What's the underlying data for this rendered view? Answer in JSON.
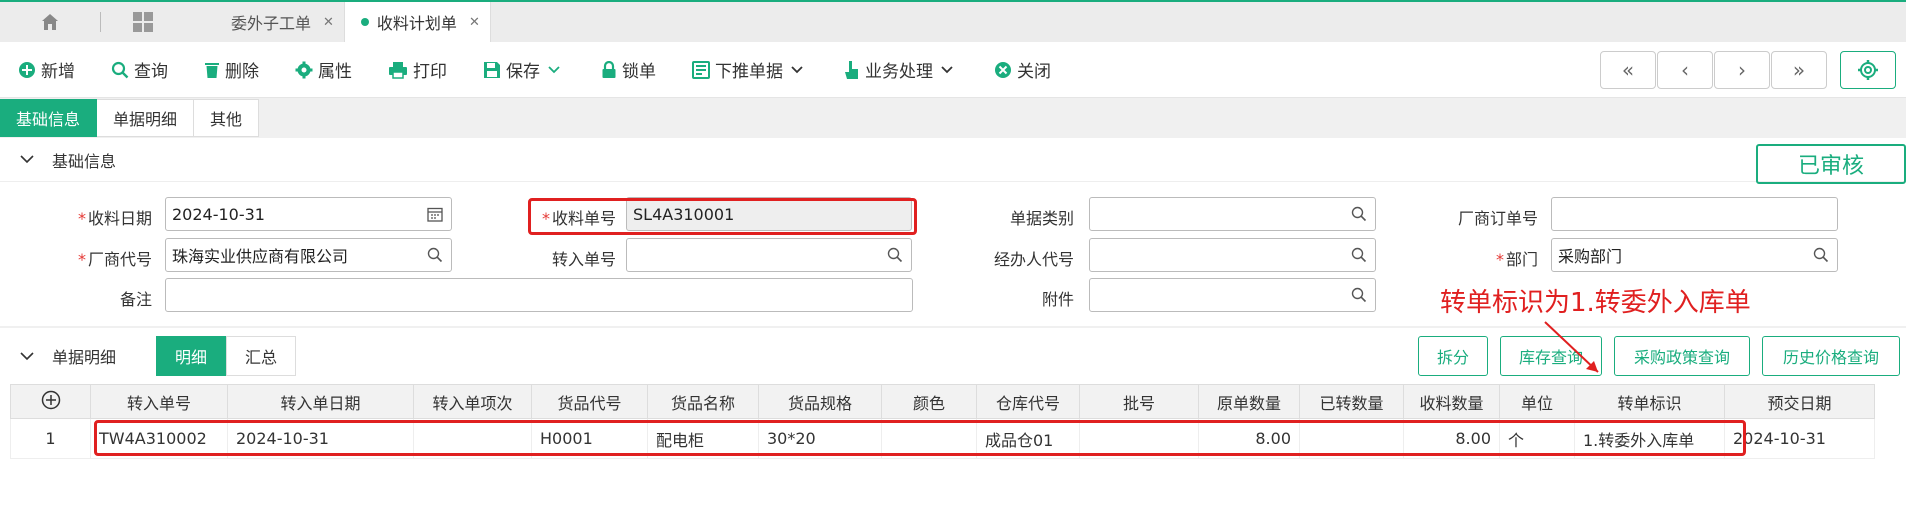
{
  "tabs": [
    {
      "label": "委外子工单",
      "active": false
    },
    {
      "label": "收料计划单",
      "active": true
    }
  ],
  "toolbar": {
    "add": "新增",
    "query": "查询",
    "delete": "删除",
    "properties": "属性",
    "print": "打印",
    "save": "保存",
    "lock": "锁单",
    "push_down": "下推单据",
    "business": "业务处理",
    "close": "关闭"
  },
  "subtabs": [
    "基础信息",
    "单据明细",
    "其他"
  ],
  "basic_section": {
    "title": "基础信息",
    "status": "已审核"
  },
  "form": {
    "receive_date_label": "收料日期",
    "receive_date": "2024-10-31",
    "receive_no_label": "收料单号",
    "receive_no": "SL4A310001",
    "doc_type_label": "单据类别",
    "doc_type": "",
    "vendor_order_label": "厂商订单号",
    "vendor_order": "",
    "vendor_code_label": "厂商代号",
    "vendor_code": "珠海实业供应商有限公司",
    "transfer_no_label": "转入单号",
    "transfer_no": "",
    "handler_label": "经办人代号",
    "handler": "",
    "dept_label": "部门",
    "dept": "采购部门",
    "remark_label": "备注",
    "remark": "",
    "attach_label": "附件",
    "attach": ""
  },
  "annotation": "转单标识为1.转委外入库单",
  "detail_section": {
    "title": "单据明细",
    "seg_detail": "明细",
    "seg_summary": "汇总",
    "actions": [
      "拆分",
      "库存查询",
      "采购政策查询",
      "历史价格查询"
    ]
  },
  "table": {
    "headers": [
      "转入单号",
      "转入单日期",
      "转入单项次",
      "货品代号",
      "货品名称",
      "货品规格",
      "颜色",
      "仓库代号",
      "批号",
      "原单数量",
      "已转数量",
      "收料数量",
      "单位",
      "转单标识",
      "预交日期"
    ],
    "rows": [
      [
        "1",
        "TW4A310002",
        "2024-10-31",
        "",
        "H0001",
        "配电柜",
        "30*20",
        "",
        "成品仓01",
        "",
        "8.00",
        "",
        "8.00",
        "个",
        "1.转委外入库单",
        "2024-10-31"
      ]
    ]
  },
  "colors": {
    "accent": "#1aad7e",
    "highlight": "#e02020"
  }
}
